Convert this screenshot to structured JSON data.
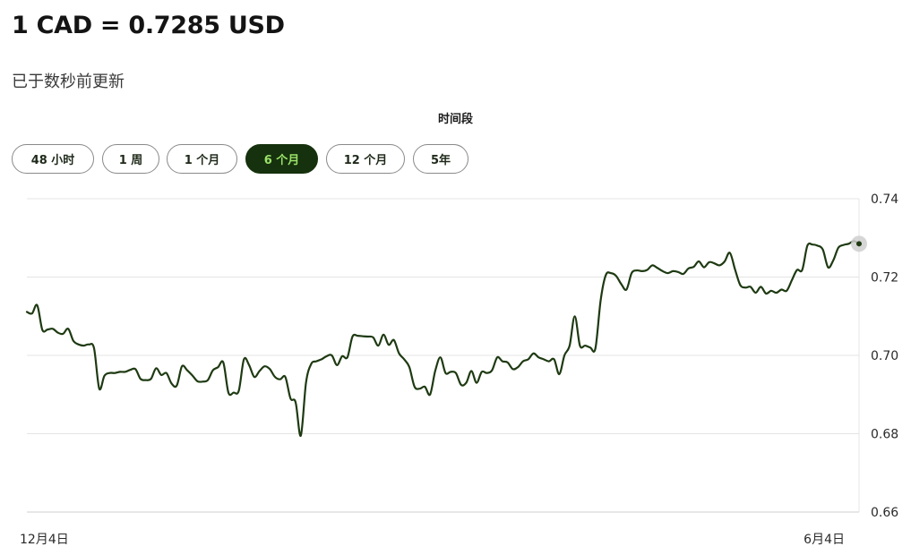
{
  "header": {
    "rate_text": "1 CAD = 0.7285 USD",
    "updated_text": "已于数秒前更新"
  },
  "period": {
    "label": "时间段",
    "options": [
      "48 小时",
      "1 周",
      "1 个月",
      "6 个月",
      "12 个月",
      "5年"
    ],
    "selected": "6 个月"
  },
  "colors": {
    "line": "#1e3a12",
    "active_bg": "#16310d",
    "active_text": "#9be36a",
    "grid": "#e4e4e4"
  },
  "chart_data": {
    "type": "line",
    "title": "",
    "xlabel": "",
    "ylabel": "",
    "x_tick_labels": [
      "12月4日",
      "6月4日"
    ],
    "ylim": [
      0.66,
      0.74
    ],
    "y_ticks": [
      "0.74",
      "0.72",
      "0.70",
      "0.68",
      "0.66"
    ],
    "grid": true,
    "series": [
      {
        "values": [
          0.7111,
          0.7107,
          0.7128,
          0.7065,
          0.7066,
          0.7068,
          0.7058,
          0.7055,
          0.7068,
          0.7037,
          0.7028,
          0.7025,
          0.7028,
          0.7018,
          0.6915,
          0.6948,
          0.6955,
          0.6955,
          0.6958,
          0.6958,
          0.6963,
          0.6965,
          0.694,
          0.6937,
          0.694,
          0.6967,
          0.695,
          0.6955,
          0.6928,
          0.6923,
          0.6972,
          0.6962,
          0.6949,
          0.6934,
          0.6933,
          0.6937,
          0.6962,
          0.697,
          0.6982,
          0.6905,
          0.6905,
          0.691,
          0.699,
          0.6975,
          0.6945,
          0.696,
          0.6972,
          0.6965,
          0.6945,
          0.6939,
          0.6945,
          0.689,
          0.688,
          0.6795,
          0.693,
          0.6978,
          0.6985,
          0.699,
          0.6998,
          0.7,
          0.6975,
          0.6998,
          0.6995,
          0.7048,
          0.705,
          0.7049,
          0.7048,
          0.7046,
          0.7025,
          0.7053,
          0.7027,
          0.7039,
          0.7005,
          0.699,
          0.697,
          0.692,
          0.6915,
          0.692,
          0.69,
          0.696,
          0.6995,
          0.6955,
          0.6958,
          0.6955,
          0.6925,
          0.693,
          0.696,
          0.693,
          0.6958,
          0.6955,
          0.6962,
          0.6995,
          0.6985,
          0.6982,
          0.6965,
          0.697,
          0.6985,
          0.699,
          0.7005,
          0.6995,
          0.699,
          0.6985,
          0.699,
          0.6952,
          0.7,
          0.7025,
          0.71,
          0.7025,
          0.7025,
          0.702,
          0.7018,
          0.714,
          0.7205,
          0.721,
          0.7203,
          0.7182,
          0.7168,
          0.721,
          0.7217,
          0.7215,
          0.7218,
          0.723,
          0.7223,
          0.7215,
          0.721,
          0.7215,
          0.7213,
          0.7208,
          0.7222,
          0.7226,
          0.724,
          0.7225,
          0.7238,
          0.7235,
          0.723,
          0.724,
          0.7262,
          0.722,
          0.718,
          0.7173,
          0.7175,
          0.716,
          0.7175,
          0.7158,
          0.7165,
          0.716,
          0.7168,
          0.7165,
          0.7192,
          0.7218,
          0.7218,
          0.728,
          0.7283,
          0.728,
          0.727,
          0.7225,
          0.7242,
          0.7275,
          0.7282,
          0.7285,
          0.7292,
          0.7285
        ]
      }
    ]
  }
}
